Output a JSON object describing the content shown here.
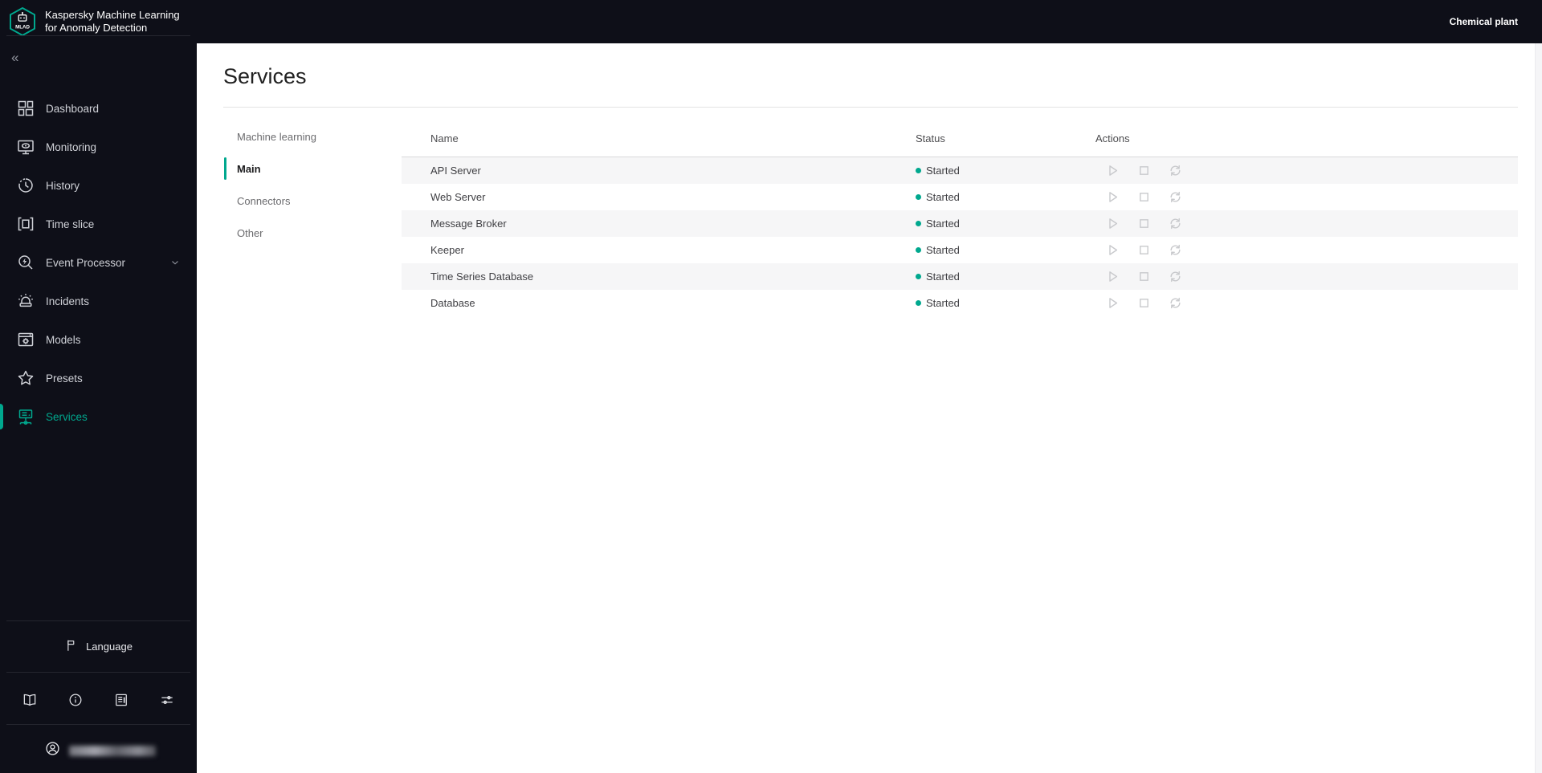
{
  "app": {
    "title_line1": "Kaspersky Machine Learning",
    "title_line2": "for Anomaly Detection",
    "logo_text": "MLAD",
    "environment": "Chemical plant",
    "accent_color": "#00a88e",
    "chrome_bg": "#0e0f18"
  },
  "sidebar": {
    "collapse_label": "«",
    "items": [
      {
        "label": "Dashboard",
        "icon": "dashboard-icon",
        "active": false,
        "has_submenu": false
      },
      {
        "label": "Monitoring",
        "icon": "monitoring-icon",
        "active": false,
        "has_submenu": false
      },
      {
        "label": "History",
        "icon": "history-icon",
        "active": false,
        "has_submenu": false
      },
      {
        "label": "Time slice",
        "icon": "time-slice-icon",
        "active": false,
        "has_submenu": false
      },
      {
        "label": "Event Processor",
        "icon": "event-processor-icon",
        "active": false,
        "has_submenu": true
      },
      {
        "label": "Incidents",
        "icon": "incidents-icon",
        "active": false,
        "has_submenu": false
      },
      {
        "label": "Models",
        "icon": "models-icon",
        "active": false,
        "has_submenu": false
      },
      {
        "label": "Presets",
        "icon": "presets-icon",
        "active": false,
        "has_submenu": false
      },
      {
        "label": "Services",
        "icon": "services-icon",
        "active": true,
        "has_submenu": false
      }
    ],
    "language_label": "Language",
    "footer_buttons": [
      {
        "icon": "book-icon"
      },
      {
        "icon": "info-icon"
      },
      {
        "icon": "release-notes-icon"
      },
      {
        "icon": "sliders-icon"
      }
    ],
    "user": {
      "email_redacted": true
    }
  },
  "page": {
    "title": "Services",
    "tabs": [
      {
        "label": "Machine learning",
        "active": false
      },
      {
        "label": "Main",
        "active": true
      },
      {
        "label": "Connectors",
        "active": false
      },
      {
        "label": "Other",
        "active": false
      }
    ]
  },
  "table": {
    "columns": [
      "Name",
      "Status",
      "Actions"
    ],
    "status_color": "#00a88e",
    "actions": [
      {
        "name": "start",
        "icon": "play-icon"
      },
      {
        "name": "stop",
        "icon": "stop-icon"
      },
      {
        "name": "restart",
        "icon": "restart-icon"
      }
    ],
    "rows": [
      {
        "name": "API Server",
        "status": "Started"
      },
      {
        "name": "Web Server",
        "status": "Started"
      },
      {
        "name": "Message Broker",
        "status": "Started"
      },
      {
        "name": "Keeper",
        "status": "Started"
      },
      {
        "name": "Time Series Database",
        "status": "Started"
      },
      {
        "name": "Database",
        "status": "Started"
      }
    ]
  }
}
